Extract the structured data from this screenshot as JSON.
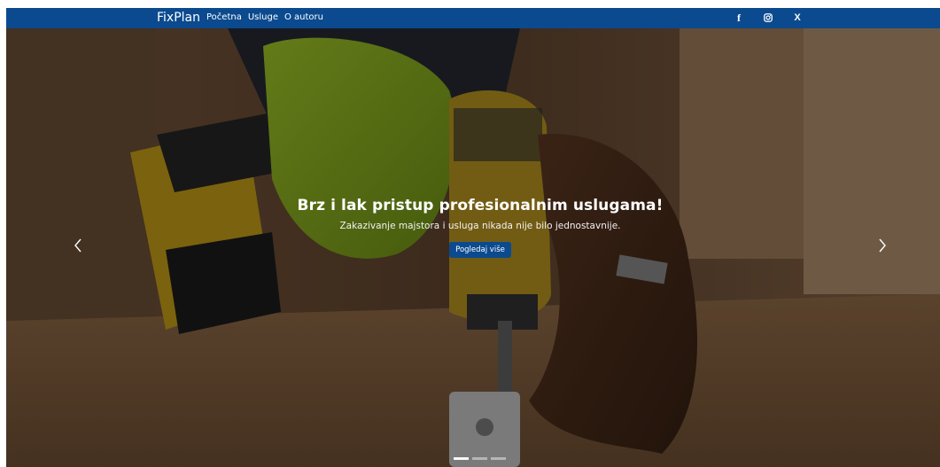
{
  "navbar": {
    "brand": "FixPlan",
    "links": [
      "Početna",
      "Usluge",
      "O autoru"
    ],
    "socials": [
      {
        "icon": "facebook-icon",
        "glyph": "f"
      },
      {
        "icon": "instagram-icon",
        "glyph": ""
      },
      {
        "icon": "x-twitter-icon",
        "glyph": "X"
      }
    ],
    "bg_color": "#0b4a8f"
  },
  "hero": {
    "title": "Brz i lak pristup profesionalnim uslugama!",
    "subtitle": "Zakazivanje majstora i usluga nikada nije bilo jednostavnije.",
    "button_label": "Pogledaj više",
    "button_color": "#0b4a8f",
    "prev_icon": "chevron-left-icon",
    "next_icon": "chevron-right-icon",
    "indicator_count": 3,
    "active_indicator": 1
  }
}
